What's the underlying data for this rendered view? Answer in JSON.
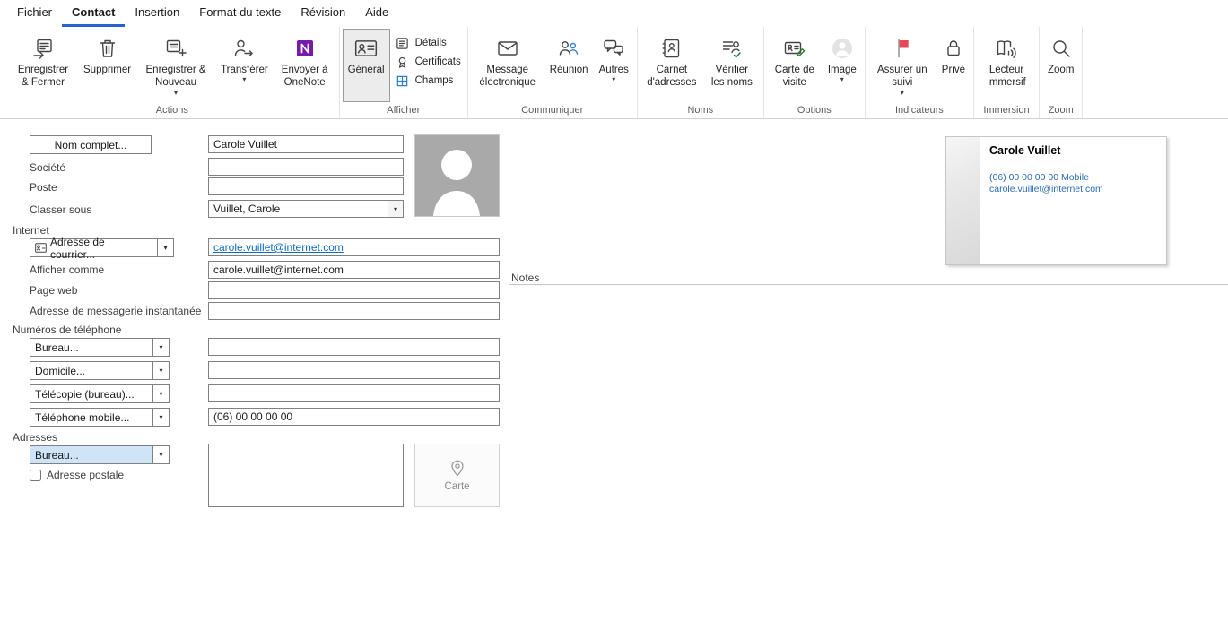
{
  "menubar": {
    "items": [
      {
        "label": "Fichier",
        "active": false
      },
      {
        "label": "Contact",
        "active": true
      },
      {
        "label": "Insertion",
        "active": false
      },
      {
        "label": "Format du texte",
        "active": false
      },
      {
        "label": "Révision",
        "active": false
      },
      {
        "label": "Aide",
        "active": false
      }
    ]
  },
  "icons": {
    "dropdown": "▾",
    "chevron_down": "⌄"
  },
  "ribbon": {
    "groups": [
      {
        "label": "Actions",
        "buttons": [
          {
            "label": "Enregistrer & Fermer"
          },
          {
            "label": "Supprimer"
          },
          {
            "label": "Enregistrer & Nouveau",
            "dropdown": true
          },
          {
            "label": "Transférer",
            "dropdown": true
          },
          {
            "label": "Envoyer à OneNote"
          }
        ]
      },
      {
        "label": "Afficher",
        "buttons": [
          {
            "label": "Général",
            "selected": true
          },
          {
            "label": "Détails"
          },
          {
            "label": "Certificats"
          },
          {
            "label": "Champs"
          }
        ]
      },
      {
        "label": "Communiquer",
        "buttons": [
          {
            "label": "Message électronique"
          },
          {
            "label": "Réunion"
          },
          {
            "label": "Autres",
            "dropdown": true
          }
        ]
      },
      {
        "label": "Noms",
        "buttons": [
          {
            "label": "Carnet d'adresses"
          },
          {
            "label": "Vérifier les noms"
          }
        ]
      },
      {
        "label": "Options",
        "buttons": [
          {
            "label": "Carte de visite"
          },
          {
            "label": "Image",
            "dropdown": true
          }
        ]
      },
      {
        "label": "Indicateurs",
        "buttons": [
          {
            "label": "Assurer un suivi",
            "dropdown": true
          },
          {
            "label": "Privé"
          }
        ]
      },
      {
        "label": "Immersion",
        "buttons": [
          {
            "label": "Lecteur immersif"
          }
        ]
      },
      {
        "label": "Zoom",
        "buttons": [
          {
            "label": "Zoom"
          }
        ]
      }
    ]
  },
  "form": {
    "full_name": {
      "button": "Nom complet...",
      "value": "Carole Vuillet"
    },
    "company": {
      "label": "Société",
      "value": ""
    },
    "job_title": {
      "label": "Poste",
      "value": ""
    },
    "file_as": {
      "label": "Classer sous",
      "value": "Vuillet, Carole"
    },
    "internet": {
      "section": "Internet",
      "email": {
        "button": "Adresse de courrier...",
        "value": "carole.vuillet@internet.com"
      },
      "display_as": {
        "label": "Afficher comme",
        "value": "carole.vuillet@internet.com"
      },
      "web_page": {
        "label": "Page web",
        "value": ""
      },
      "im": {
        "label": "Adresse de messagerie instantanée",
        "value": ""
      }
    },
    "phones": {
      "section": "Numéros de téléphone",
      "rows": [
        {
          "button": "Bureau...",
          "value": ""
        },
        {
          "button": "Domicile...",
          "value": ""
        },
        {
          "button": "Télécopie (bureau)...",
          "value": ""
        },
        {
          "button": "Téléphone mobile...",
          "value": "(06) 00 00 00 00"
        }
      ]
    },
    "addresses": {
      "section": "Adresses",
      "button": "Bureau...",
      "postal_checkbox": "Adresse postale",
      "value": "",
      "map_button": "Carte"
    }
  },
  "business_card": {
    "name": "Carole Vuillet",
    "phone_line": "(06) 00 00 00 00 Mobile",
    "email_line": "carole.vuillet@internet.com"
  },
  "notes_label": "Notes",
  "colors": {
    "accent_blue": "#2564cf",
    "link_blue": "#0f6cbd",
    "flag_red": "#e74856",
    "onenote_purple": "#7719aa",
    "highlight_blue": "#cfe4f7"
  }
}
